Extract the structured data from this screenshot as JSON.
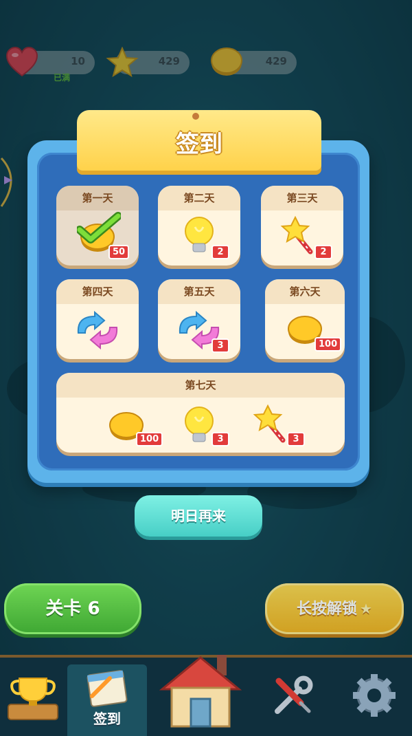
{
  "top_bar": {
    "hearts": {
      "value": "10",
      "status": "已满"
    },
    "stars": {
      "value": "429"
    },
    "coins": {
      "value": "429"
    }
  },
  "dialog": {
    "title": "签到",
    "days": [
      {
        "label": "第一天",
        "reward_count": "50",
        "reward": "coin-icon",
        "claimed": true
      },
      {
        "label": "第二天",
        "reward_count": "2",
        "reward": "lightbulb-icon",
        "claimed": false
      },
      {
        "label": "第三天",
        "reward_count": "2",
        "reward": "star-wand-icon",
        "claimed": false
      },
      {
        "label": "第四天",
        "reward_count": "",
        "reward": "swap-arrows-icon",
        "claimed": false
      },
      {
        "label": "第五天",
        "reward_count": "3",
        "reward": "swap-arrows-icon",
        "claimed": false
      },
      {
        "label": "第六天",
        "reward_count": "100",
        "reward": "coin-icon",
        "claimed": false
      }
    ],
    "day7": {
      "label": "第七天",
      "rewards": [
        {
          "reward": "coin-icon",
          "count": "100"
        },
        {
          "reward": "lightbulb-icon",
          "count": "3"
        },
        {
          "reward": "star-wand-icon",
          "count": "3"
        }
      ]
    },
    "button_label": "明日再来"
  },
  "buttons": {
    "level": "关卡 6",
    "unlock": "长按解锁"
  },
  "nav": {
    "items": [
      {
        "name": "trophy",
        "label": ""
      },
      {
        "name": "checkin",
        "label": "签到"
      },
      {
        "name": "home",
        "label": ""
      },
      {
        "name": "tools",
        "label": ""
      },
      {
        "name": "settings",
        "label": ""
      }
    ]
  },
  "colors": {
    "background": "#164f5c",
    "panel": "#5db3ea",
    "panel_inner": "#2f6dba",
    "title_tab": "#ffd24a",
    "tomorrow_button": "#47cfc6",
    "level_button": "#3ea733",
    "unlock_button": "#f3b21b",
    "badge": "#e23b3b"
  }
}
